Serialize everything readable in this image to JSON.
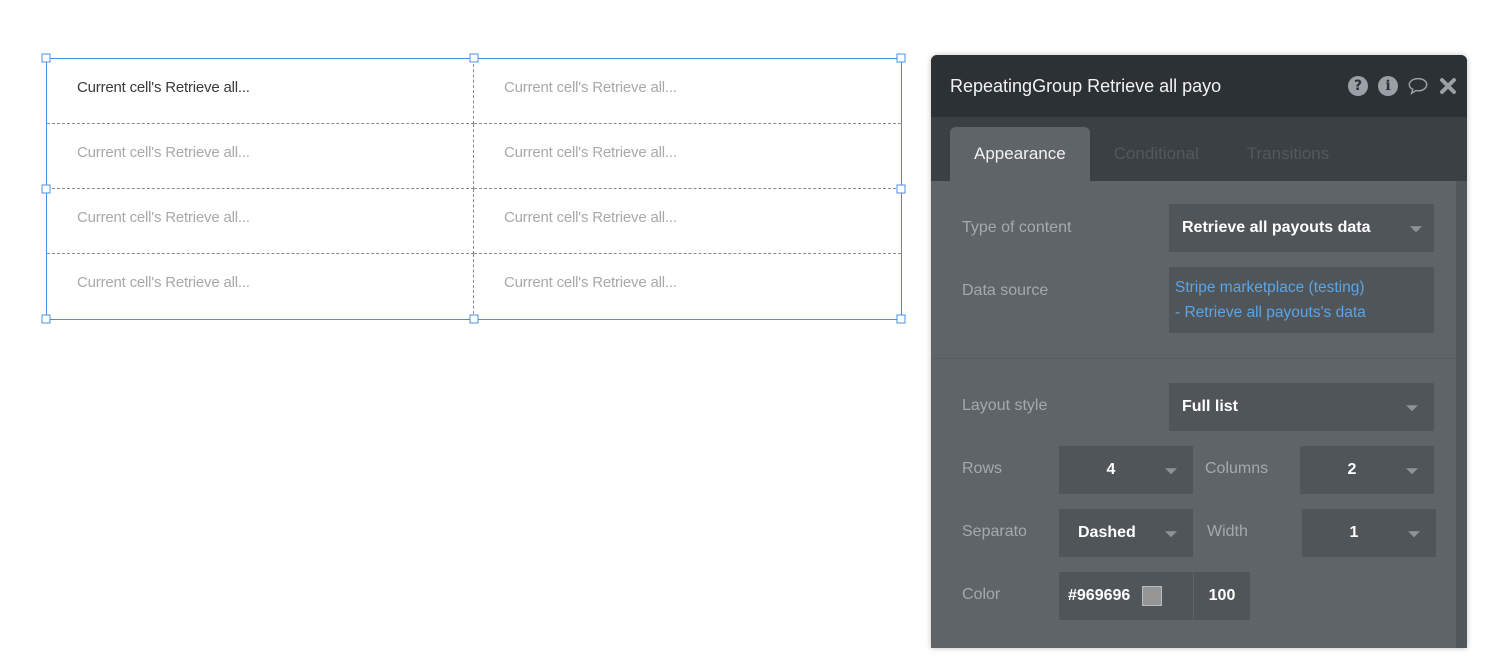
{
  "canvas": {
    "repeating_group": {
      "rows": 4,
      "columns": 2,
      "cells": [
        [
          "Current cell's Retrieve all...",
          "Current cell's Retrieve all..."
        ],
        [
          "Current cell's Retrieve all...",
          "Current cell's Retrieve all..."
        ],
        [
          "Current cell's Retrieve all...",
          "Current cell's Retrieve all..."
        ],
        [
          "Current cell's Retrieve all...",
          "Current cell's Retrieve all..."
        ]
      ],
      "selection_color": "#4a90e2",
      "separator_color": "#969696"
    }
  },
  "panel": {
    "title": "RepeatingGroup Retrieve all payo",
    "icons": [
      "help-icon",
      "info-icon",
      "comment-icon",
      "close-icon"
    ],
    "tabs": [
      {
        "label": "Appearance",
        "active": true
      },
      {
        "label": "Conditional",
        "active": false
      },
      {
        "label": "Transitions",
        "active": false
      }
    ],
    "fields": {
      "type_of_content": {
        "label": "Type of content",
        "value": "Retrieve all payouts data"
      },
      "data_source": {
        "label": "Data source",
        "line1": "Stripe marketplace (testing)",
        "line2": "- Retrieve all payouts's data"
      },
      "layout_style": {
        "label": "Layout style",
        "value": "Full list"
      },
      "rows": {
        "label": "Rows",
        "value": "4"
      },
      "columns": {
        "label": "Columns",
        "value": "2"
      },
      "separator": {
        "label": "Separato",
        "value": "Dashed"
      },
      "width": {
        "label": "Width",
        "value": "1"
      },
      "color": {
        "label": "Color",
        "hex": "#969696",
        "opacity": "100"
      }
    },
    "colors": {
      "header_bg": "#2b3135",
      "body_bg": "#5f6468",
      "link": "#5ba4e5"
    }
  }
}
